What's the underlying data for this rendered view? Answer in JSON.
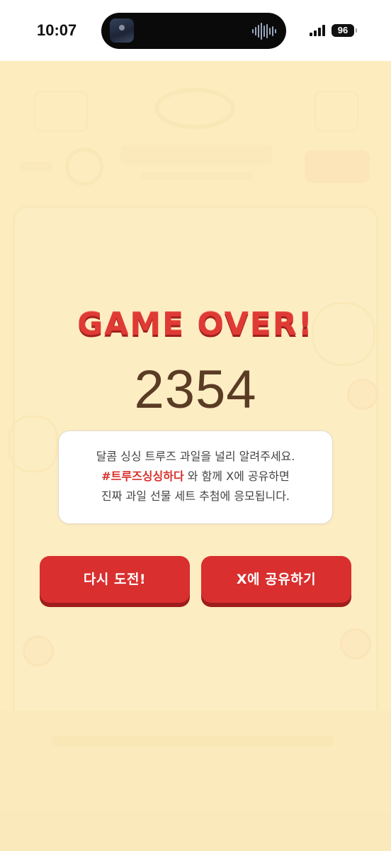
{
  "status_bar": {
    "time": "10:07",
    "battery": "96"
  },
  "game": {
    "over_title": "GAME OVER!",
    "score": "2354"
  },
  "share_message": {
    "line1": "달콤 싱싱 트루즈 과일을 널리 알려주세요.",
    "hashtag": "#트루즈싱싱하다",
    "line2_rest": " 와 함께 X에 공유하면",
    "line3": "진짜 과일 선물 세트 추첨에 응모됩니다."
  },
  "buttons": {
    "retry_label": "다시 도전!",
    "share_label": "X에 공유하기"
  },
  "colors": {
    "accent_red": "#d92f2f",
    "overlay": "#fcecbe",
    "score_brown": "#5a3b24"
  }
}
